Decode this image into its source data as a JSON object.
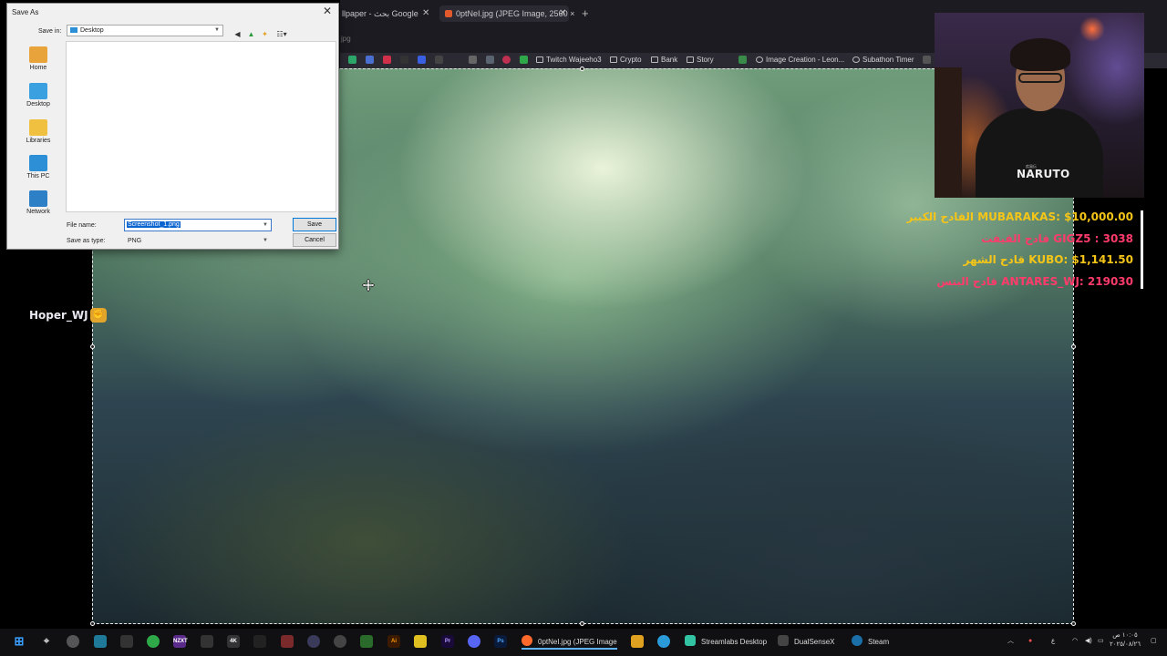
{
  "browser": {
    "tabs": [
      {
        "label": "llpaper - بحث Google",
        "active": false
      },
      {
        "label": "0ptNeI.jpg (JPEG Image, 2560 ×",
        "active": true
      }
    ],
    "url": "jpg",
    "bookmarks": [
      {
        "label": "Twitch Wajeeho3"
      },
      {
        "label": "Crypto"
      },
      {
        "label": "Bank"
      },
      {
        "label": "Story"
      },
      {
        "label": "Image Creation - Leon..."
      },
      {
        "label": "Subathon Timer"
      }
    ]
  },
  "dialog": {
    "title": "Save As",
    "save_in_label": "Save in:",
    "save_in_value": "Desktop",
    "places": [
      {
        "label": "Home",
        "color": "#e8a33a"
      },
      {
        "label": "Desktop",
        "color": "#3aa0e0"
      },
      {
        "label": "Libraries",
        "color": "#f0c040"
      },
      {
        "label": "This PC",
        "color": "#2d8fd6"
      },
      {
        "label": "Network",
        "color": "#2d7fc6"
      }
    ],
    "file_name_label": "File name:",
    "file_name_value": "Screenshot_1.png",
    "save_type_label": "Save as type:",
    "save_type_value": "PNG",
    "save_button": "Save",
    "cancel_button": "Cancel"
  },
  "overlay": {
    "webcam_shirt_text": "NARUTO",
    "webcam_shirt_subtext": "疾風伝",
    "leaderboard": [
      {
        "text": "القادح الكبير MUBARAKAS: $10,000.00",
        "color": "#f5c518"
      },
      {
        "text": "قادح القيفت GIGZ5 : 3038",
        "color": "#ff3b6b"
      },
      {
        "text": "قادح الشهر KUBO: $1,141.50",
        "color": "#f5c518"
      },
      {
        "text": "قادح البتس ANTARES_WJ: 219030",
        "color": "#ff3b6b"
      }
    ],
    "chat_user": "Hoper_WJ"
  },
  "taskbar": {
    "apps": [
      {
        "label": "0ptNeI.jpg (JPEG Image",
        "color": "#ff6a2c",
        "active": true
      },
      {
        "label": "Streamlabs Desktop",
        "color": "#31c3a2",
        "active": false
      },
      {
        "label": "DualSenseX",
        "color": "#444",
        "active": false
      },
      {
        "label": "Steam",
        "color": "#1b6fa8",
        "active": false
      }
    ],
    "pinned_labels": {
      "nzxt": "NZXT",
      "four_k": "4K",
      "ai": "Ai",
      "pr": "Pr",
      "ps": "Ps"
    },
    "clock_time": "١٠:٠٥ ص",
    "clock_date": "٢٠٢٥/٠٨/٢٦",
    "language": "ع"
  }
}
